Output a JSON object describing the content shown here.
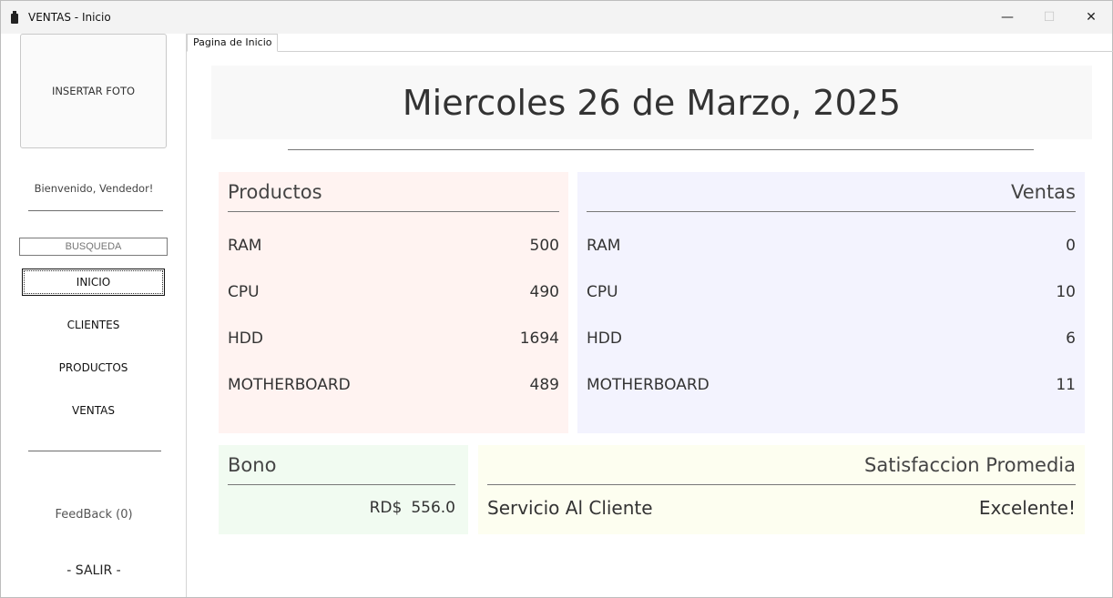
{
  "window": {
    "title": "VENTAS - Inicio",
    "controls": {
      "minimize": "—",
      "maximize": "☐",
      "close": "✕"
    }
  },
  "sidebar": {
    "photo_label": "INSERTAR FOTO",
    "welcome": "Bienvenido, Vendedor!",
    "search_placeholder": "BUSQUEDA",
    "nav": [
      {
        "label": "INICIO"
      },
      {
        "label": "CLIENTES"
      },
      {
        "label": "PRODUCTOS"
      },
      {
        "label": "VENTAS"
      }
    ],
    "feedback": "FeedBack (0)",
    "logout": "- SALIR -"
  },
  "tabs": [
    {
      "label": "Pagina de Inicio"
    }
  ],
  "main": {
    "date": "Miercoles 26 de Marzo, 2025",
    "productos": {
      "title": "Productos",
      "rows": [
        {
          "name": "RAM",
          "value": "500"
        },
        {
          "name": "CPU",
          "value": "490"
        },
        {
          "name": "HDD",
          "value": "1694"
        },
        {
          "name": "MOTHERBOARD",
          "value": "489"
        }
      ]
    },
    "ventas": {
      "title": "Ventas",
      "rows": [
        {
          "name": "RAM",
          "value": "0"
        },
        {
          "name": "CPU",
          "value": "10"
        },
        {
          "name": "HDD",
          "value": "6"
        },
        {
          "name": "MOTHERBOARD",
          "value": "11"
        }
      ]
    },
    "bono": {
      "title": "Bono",
      "currency": "RD$",
      "amount": "556.0"
    },
    "satisfaccion": {
      "title": "Satisfaccion Promedia",
      "label": "Servicio Al Cliente",
      "value": "Excelente!"
    }
  },
  "colors": {
    "productos_bg": "#fff3f1",
    "ventas_bg": "#f3f3fe",
    "bono_bg": "#f1fbf1",
    "satisfaccion_bg": "#fdfef0"
  }
}
